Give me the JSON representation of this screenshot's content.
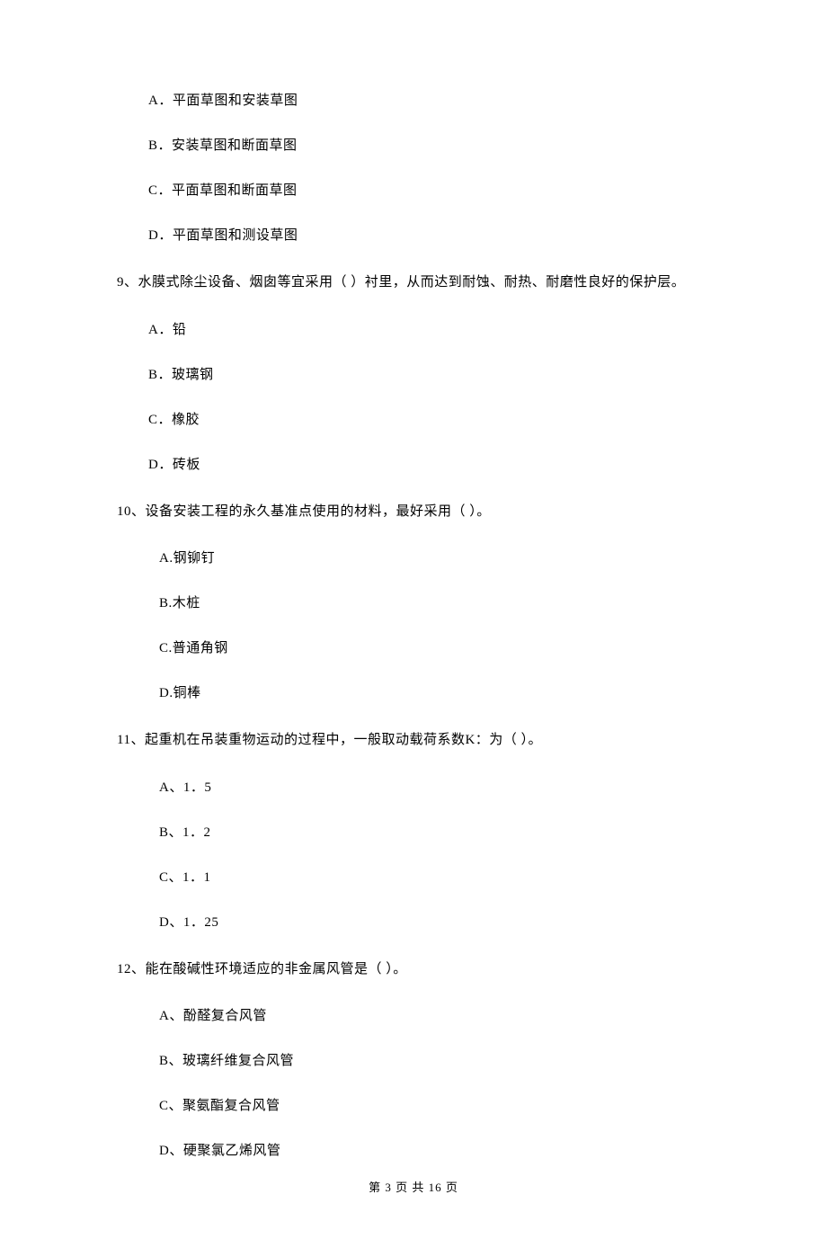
{
  "q8_options": {
    "A": "A．平面草图和安装草图",
    "B": "B．安装草图和断面草图",
    "C": "C．平面草图和断面草图",
    "D": "D．平面草图和测设草图"
  },
  "q9": {
    "text": "9、水膜式除尘设备、烟囱等宜采用（    ）衬里，从而达到耐蚀、耐热、耐磨性良好的保护层。",
    "options": {
      "A": "A．铅",
      "B": "B．玻璃钢",
      "C": "C．橡胶",
      "D": "D．砖板"
    }
  },
  "q10": {
    "text": "10、设备安装工程的永久基准点使用的材料，最好采用（    ）。",
    "options": {
      "A": "A.钢铆钉",
      "B": "B.木桩",
      "C": "C.普通角钢",
      "D": "D.铜棒"
    }
  },
  "q11": {
    "text": "11、起重机在吊装重物运动的过程中，一般取动载荷系数K：为（    ）。",
    "options": {
      "A": "A、1．5",
      "B": "B、1．2",
      "C": "C、1．1",
      "D": "D、1．25"
    }
  },
  "q12": {
    "text": "12、能在酸碱性环境适应的非金属风管是（    ）。",
    "options": {
      "A": "A、酚醛复合风管",
      "B": "B、玻璃纤维复合风管",
      "C": "C、聚氨酯复合风管",
      "D": "D、硬聚氯乙烯风管"
    }
  },
  "footer": "第 3 页 共 16 页"
}
